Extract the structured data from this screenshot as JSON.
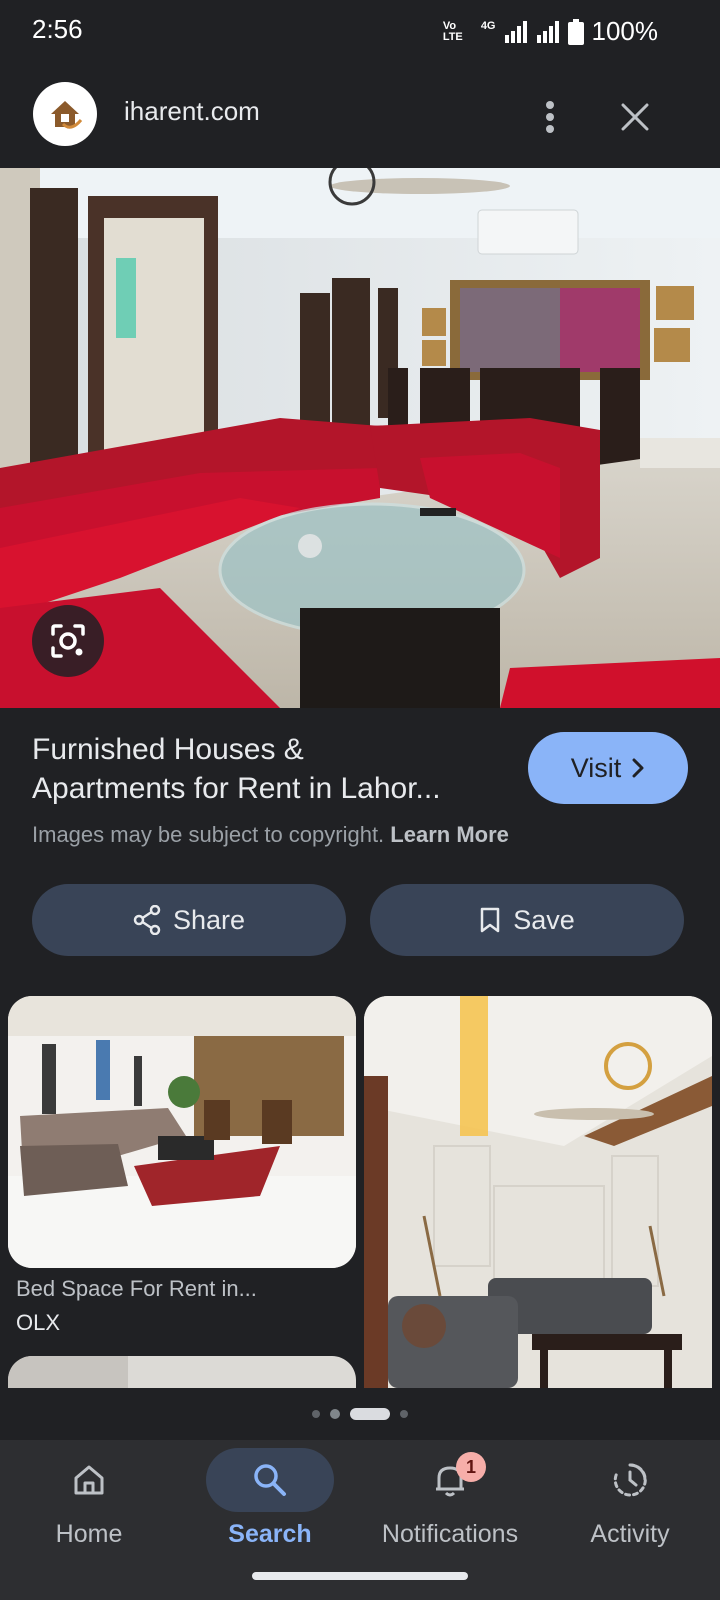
{
  "status_bar": {
    "time": "2:56",
    "network": "4G",
    "volte_label": "VoLTE",
    "battery": "100%"
  },
  "header": {
    "domain": "iharent.com",
    "logo_icon": "house-key-logo",
    "more_icon": "more-vert-icon",
    "close_icon": "close-icon"
  },
  "result": {
    "title_line1": "Furnished Houses &",
    "title_line2": "Apartments for Rent in Lahor...",
    "visit_label": "Visit",
    "copyright_text": "Images may be subject to copyright.",
    "learn_more": "Learn More"
  },
  "actions": {
    "share_label": "Share",
    "save_label": "Save"
  },
  "related": [
    {
      "caption": "Bed Space For Rent in...",
      "source": "OLX"
    },
    {
      "caption": "",
      "source": ""
    }
  ],
  "pager": {
    "count": 4,
    "active_index": 2
  },
  "bottom_nav": {
    "items": [
      {
        "label": "Home",
        "icon": "home-icon"
      },
      {
        "label": "Search",
        "icon": "search-icon"
      },
      {
        "label": "Notifications",
        "icon": "bell-icon",
        "badge": "1"
      },
      {
        "label": "Activity",
        "icon": "activity-icon"
      }
    ],
    "active": "Search"
  },
  "colors": {
    "background": "#202124",
    "accent": "#8ab4f8",
    "button_bg": "#394457",
    "sofa_red": "#c8102e"
  }
}
